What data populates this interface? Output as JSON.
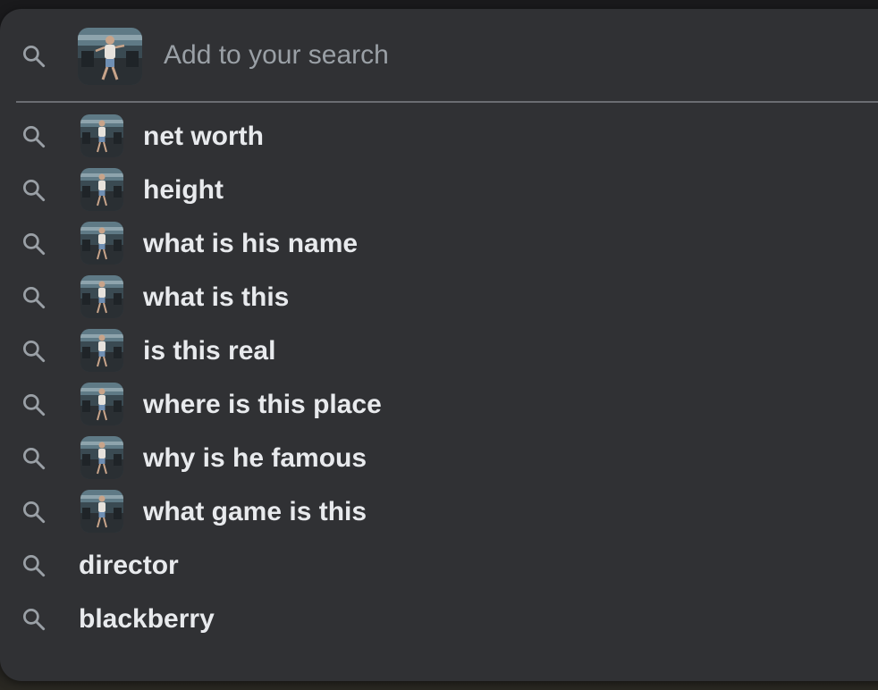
{
  "search": {
    "placeholder": "Add to your search",
    "value": "",
    "icon": "search-icon",
    "image_attachment": "photo-thumbnail"
  },
  "suggestions": [
    {
      "label": "net worth",
      "has_thumbnail": true
    },
    {
      "label": "height",
      "has_thumbnail": true
    },
    {
      "label": "what is his name",
      "has_thumbnail": true
    },
    {
      "label": "what is this",
      "has_thumbnail": true
    },
    {
      "label": "is this real",
      "has_thumbnail": true
    },
    {
      "label": "where is this place",
      "has_thumbnail": true
    },
    {
      "label": "why is he famous",
      "has_thumbnail": true
    },
    {
      "label": "what game is this",
      "has_thumbnail": true
    },
    {
      "label": "director",
      "has_thumbnail": false
    },
    {
      "label": "blackberry",
      "has_thumbnail": false
    }
  ],
  "colors": {
    "panel": "#303134",
    "text": "#e8eaed",
    "placeholder": "#9aa0a6",
    "icon": "#9aa0a6",
    "divider": "#6b6d72"
  }
}
